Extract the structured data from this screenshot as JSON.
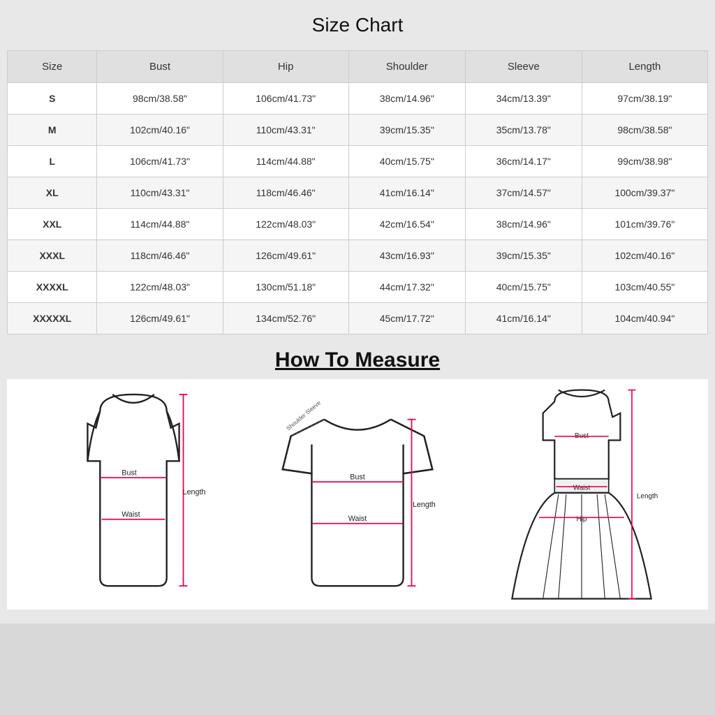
{
  "page": {
    "title": "Size Chart",
    "how_to_measure": "How To Measure"
  },
  "table": {
    "headers": [
      "Size",
      "Bust",
      "Hip",
      "Shoulder",
      "Sleeve",
      "Length"
    ],
    "rows": [
      [
        "S",
        "98cm/38.58\"",
        "106cm/41.73\"",
        "38cm/14.96\"",
        "34cm/13.39\"",
        "97cm/38.19\""
      ],
      [
        "M",
        "102cm/40.16\"",
        "110cm/43.31\"",
        "39cm/15.35\"",
        "35cm/13.78\"",
        "98cm/38.58\""
      ],
      [
        "L",
        "106cm/41.73\"",
        "114cm/44.88\"",
        "40cm/15.75\"",
        "36cm/14.17\"",
        "99cm/38.98\""
      ],
      [
        "XL",
        "110cm/43.31\"",
        "118cm/46.46\"",
        "41cm/16.14\"",
        "37cm/14.57\"",
        "100cm/39.37\""
      ],
      [
        "XXL",
        "114cm/44.88\"",
        "122cm/48.03\"",
        "42cm/16.54\"",
        "38cm/14.96\"",
        "101cm/39.76\""
      ],
      [
        "XXXL",
        "118cm/46.46\"",
        "126cm/49.61\"",
        "43cm/16.93\"",
        "39cm/15.35\"",
        "102cm/40.16\""
      ],
      [
        "XXXXL",
        "122cm/48.03\"",
        "130cm/51.18\"",
        "44cm/17.32\"",
        "40cm/15.75\"",
        "103cm/40.55\""
      ],
      [
        "XXXXXL",
        "126cm/49.61\"",
        "134cm/52.76\"",
        "45cm/17.72\"",
        "41cm/16.14\"",
        "104cm/40.94\""
      ]
    ]
  }
}
